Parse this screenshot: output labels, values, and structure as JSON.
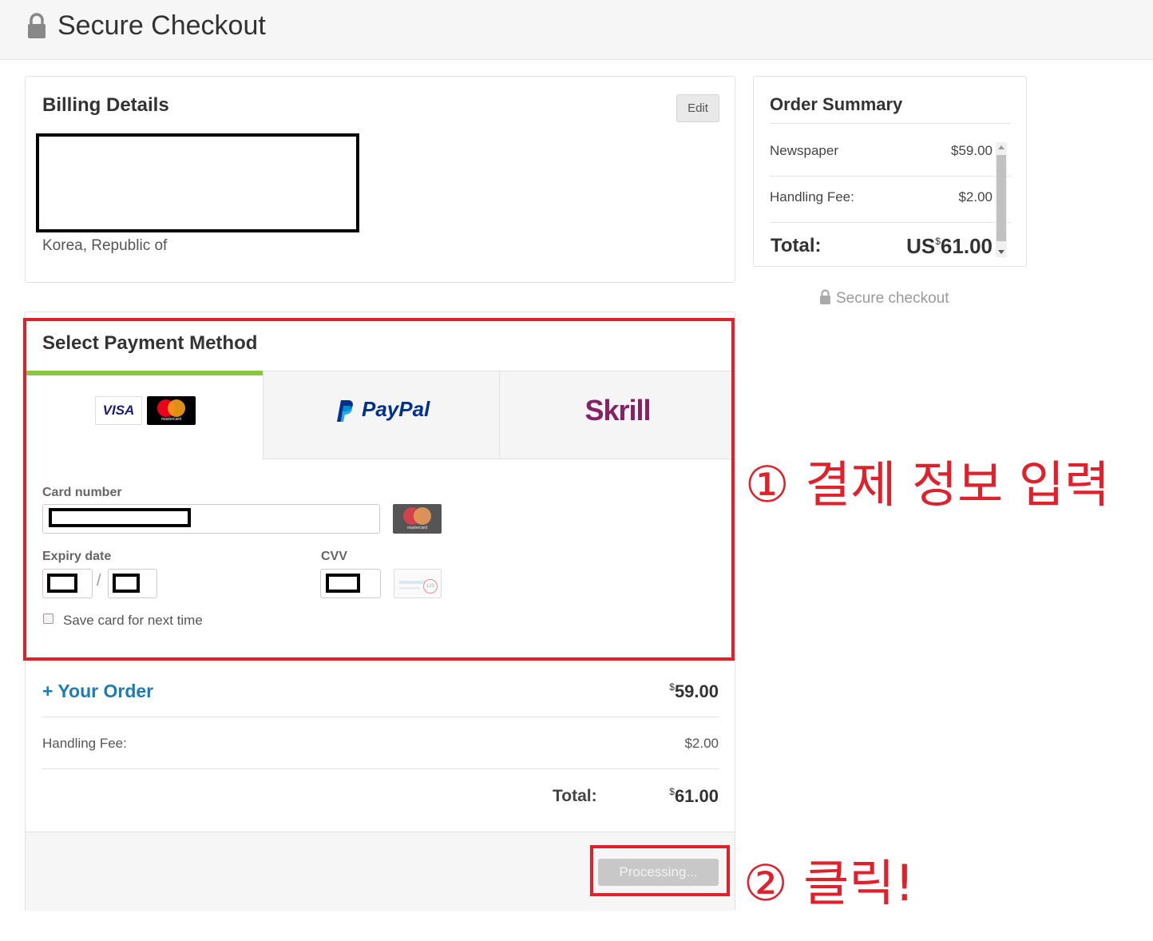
{
  "header": {
    "title": "Secure Checkout",
    "icon": "lock-icon"
  },
  "billing": {
    "title": "Billing Details",
    "edit_label": "Edit",
    "country": "Korea, Republic of"
  },
  "payment": {
    "title": "Select Payment Method",
    "tabs": [
      {
        "label": "VISA",
        "icon": "visa-mastercard-icon"
      },
      {
        "label": "PayPal",
        "icon": "paypal-logo"
      },
      {
        "label": "Skrill",
        "icon": "skrill-logo"
      }
    ],
    "card_number_label": "Card number",
    "expiry_label": "Expiry date",
    "expiry_separator": "/",
    "cvv_label": "CVV",
    "save_card_label": "Save card for next time",
    "mastercard_text": "mastercard",
    "cvv_hint": "123"
  },
  "order": {
    "your_order_label": "+ Your Order",
    "your_order_currency": "$",
    "your_order_amount": "59.00",
    "handling_label": "Handling Fee:",
    "handling_value": "$2.00",
    "total_label": "Total:",
    "total_currency": "$",
    "total_amount": "61.00",
    "button_label": "Processing..."
  },
  "summary": {
    "title": "Order Summary",
    "items": [
      {
        "label": "Newspaper",
        "value": "$59.00"
      },
      {
        "label": "Handling Fee:",
        "value": "$2.00"
      }
    ],
    "total_label": "Total:",
    "total_prefix": "US",
    "total_currency": "$",
    "total_amount": "61.00"
  },
  "secure_note": "Secure checkout",
  "annotations": {
    "step1": "① 결제 정보 입력",
    "step2": "② 클릭!",
    "color": "#e0202a"
  },
  "colors": {
    "accent": "#8cc63f",
    "link": "#1b7cb8",
    "skrill": "#862165"
  }
}
